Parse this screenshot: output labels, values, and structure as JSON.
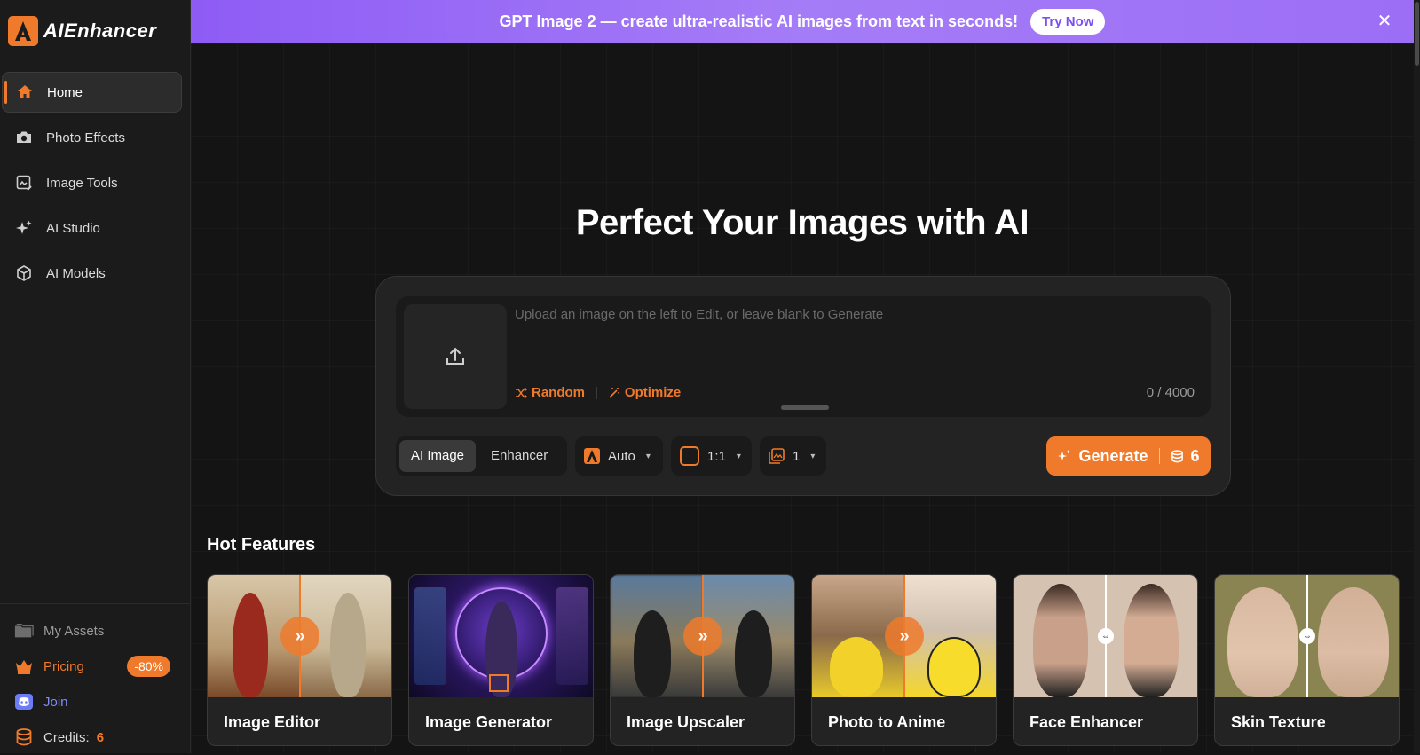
{
  "brand": {
    "name": "AIEnhancer",
    "accent": "#ef7a2b"
  },
  "banner": {
    "text": "GPT Image 2 — create ultra-realistic AI images from text in seconds!",
    "cta": "Try Now",
    "close_icon": "close-icon"
  },
  "sidebar": {
    "items": [
      {
        "label": "Home",
        "icon": "home-icon",
        "active": true
      },
      {
        "label": "Photo Effects",
        "icon": "camera-icon"
      },
      {
        "label": "Image Tools",
        "icon": "image-edit-icon"
      },
      {
        "label": "AI Studio",
        "icon": "sparkles-icon"
      },
      {
        "label": "AI Models",
        "icon": "cube-icon"
      }
    ],
    "bottom": {
      "assets": "My Assets",
      "pricing": "Pricing",
      "discount": "-80%",
      "join": "Join",
      "credits_label": "Credits:",
      "credits_value": "6"
    }
  },
  "hero": {
    "title": "Perfect Your Images with AI"
  },
  "prompt": {
    "placeholder": "Upload an image on the left to Edit, or leave blank to Generate",
    "random": "Random",
    "optimize": "Optimize",
    "counter": "0 / 4000"
  },
  "controls": {
    "modes": [
      "AI Image",
      "Enhancer"
    ],
    "model": "Auto",
    "ratio": "1:1",
    "count": "1",
    "generate": "Generate",
    "generate_cost": "6"
  },
  "hot_features": {
    "title": "Hot Features",
    "cards": [
      {
        "label": "Image Editor"
      },
      {
        "label": "Image Generator"
      },
      {
        "label": "Image Upscaler"
      },
      {
        "label": "Photo to Anime"
      },
      {
        "label": "Face Enhancer"
      },
      {
        "label": "Skin Texture"
      }
    ]
  }
}
